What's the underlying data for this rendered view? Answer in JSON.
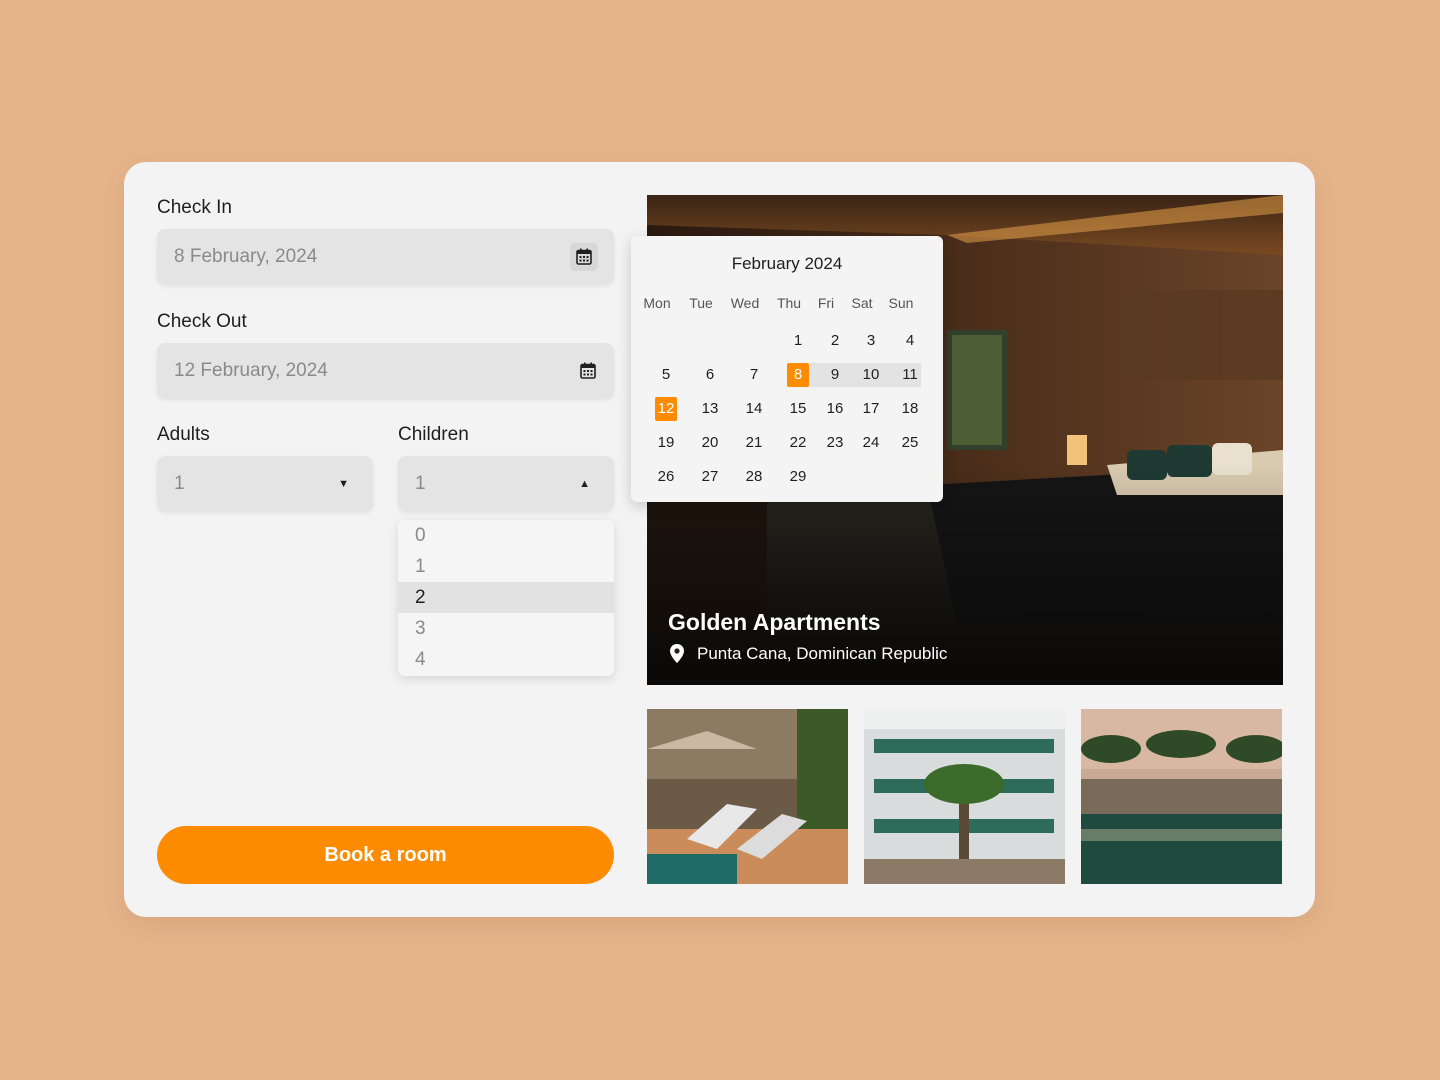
{
  "check_in": {
    "label": "Check In",
    "value": "8 February, 2024",
    "icon": "calendar-icon"
  },
  "check_out": {
    "label": "Check Out",
    "value": "12 February, 2024",
    "icon": "calendar-icon"
  },
  "adults": {
    "label": "Adults",
    "value": "1",
    "icon": "caret-down-icon"
  },
  "children": {
    "label": "Children",
    "value": "1",
    "icon": "caret-up-icon",
    "options": [
      "0",
      "1",
      "2",
      "3",
      "4"
    ],
    "highlighted": "2"
  },
  "book_button": "Book a room",
  "hotel": {
    "name": "Golden Apartments",
    "location": "Punta Cana, Dominican Republic",
    "icon": "location-pin-icon"
  },
  "calendar": {
    "title": "February 2024",
    "weekdays": [
      "Mon",
      "Tue",
      "Wed",
      "Thu",
      "Fri",
      "Sat",
      "Sun"
    ],
    "weeks": [
      [
        "",
        "",
        "",
        "1",
        "2",
        "3",
        "4"
      ],
      [
        "5",
        "6",
        "7",
        "8",
        "9",
        "10",
        "11"
      ],
      [
        "12",
        "13",
        "14",
        "15",
        "16",
        "17",
        "18"
      ],
      [
        "19",
        "20",
        "21",
        "22",
        "23",
        "24",
        "25"
      ],
      [
        "26",
        "27",
        "28",
        "29",
        "",
        "",
        ""
      ]
    ],
    "range_start": "8",
    "range_end": "12"
  },
  "colors": {
    "accent": "#ff8c00",
    "background": "#e5b48b",
    "card": "#f3f3f3",
    "field": "#e4e4e4"
  }
}
